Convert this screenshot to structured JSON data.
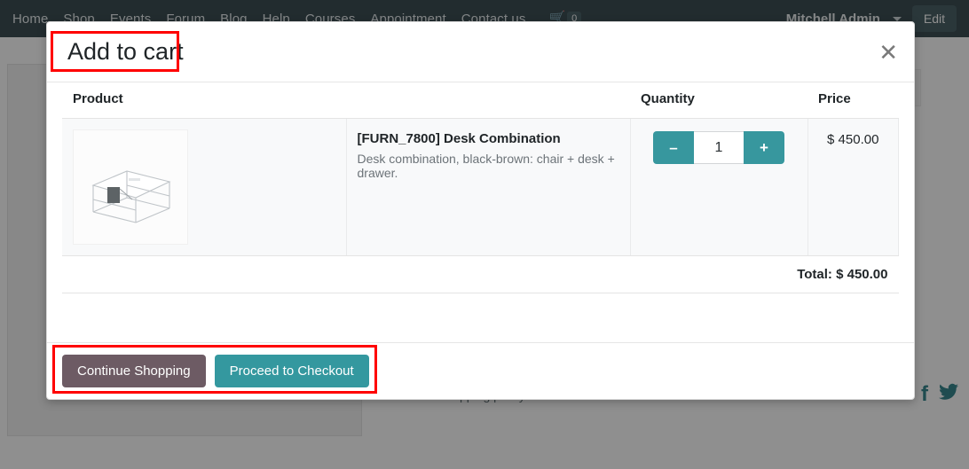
{
  "topnav": {
    "links": [
      {
        "label": "Home"
      },
      {
        "label": "Shop"
      },
      {
        "label": "Events"
      },
      {
        "label": "Forum"
      },
      {
        "label": "Blog"
      },
      {
        "label": "Help"
      },
      {
        "label": "Courses"
      },
      {
        "label": "Appointment"
      },
      {
        "label": "Contact us"
      }
    ],
    "cart_icon": "shopping-cart-icon",
    "cart_count": "0",
    "user_name": "Mitchell Admin",
    "edit_label": "Edit"
  },
  "page": {
    "footer_note": "shipping policy",
    "social": [
      {
        "icon": "facebook-icon",
        "glyph": "f"
      },
      {
        "icon": "twitter-icon",
        "glyph": "ᴠ"
      }
    ]
  },
  "modal": {
    "title": "Add to cart",
    "close_icon": "close-icon",
    "headers": {
      "product": "Product",
      "quantity": "Quantity",
      "price": "Price"
    },
    "items": [
      {
        "image_alt": "desk-combination-thumbnail",
        "name": "[FURN_7800] Desk Combination",
        "description": "Desk combination, black-brown: chair + desk + drawer.",
        "qty_decrease_icon": "minus-icon",
        "qty_decrease_glyph": "–",
        "qty_value": "1",
        "qty_increase_icon": "plus-icon",
        "qty_increase_glyph": "+",
        "price": "$ 450.00"
      }
    ],
    "total_label": "Total: $ 450.00",
    "footer": {
      "continue_label": "Continue Shopping",
      "checkout_label": "Proceed to Checkout"
    }
  },
  "colors": {
    "teal": "#34989f",
    "mauve": "#6d5b64",
    "nav_dark": "#2e4248",
    "highlight": "#ff0000"
  }
}
